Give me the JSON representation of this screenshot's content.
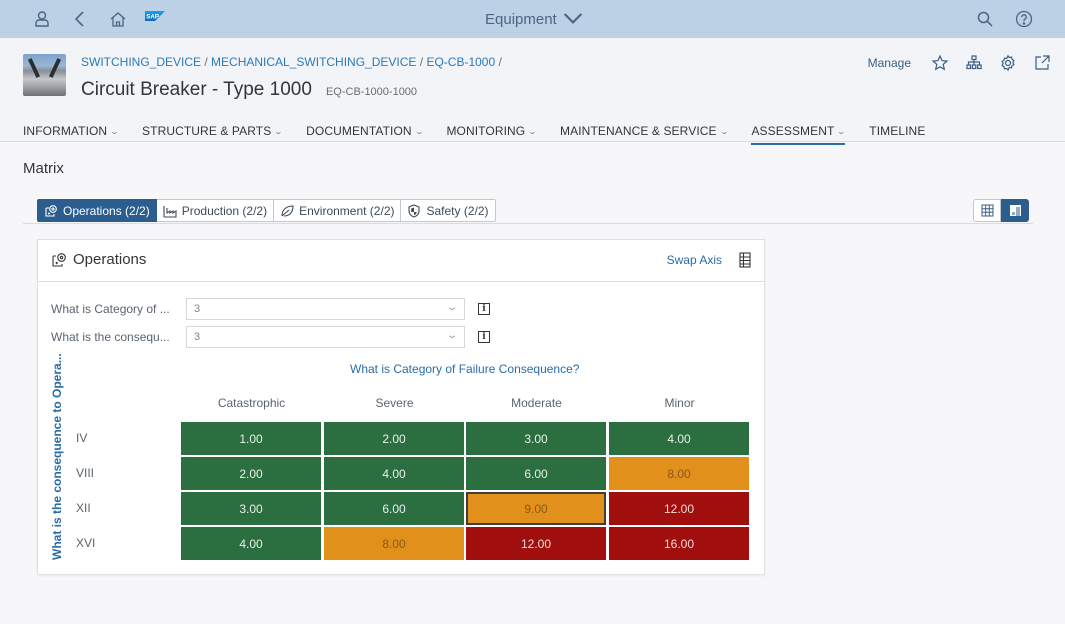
{
  "shell": {
    "title": "Equipment",
    "logo_text": "SAP",
    "icons": [
      "user-icon",
      "back-icon",
      "home-icon",
      "search-icon",
      "help-icon"
    ]
  },
  "header": {
    "breadcrumbs": [
      "SWITCHING_DEVICE",
      "MECHANICAL_SWITCHING_DEVICE",
      "EQ-CB-1000"
    ],
    "breadcrumb_separator": "/",
    "title": "Circuit Breaker - Type 1000",
    "subtitle": "EQ-CB-1000-1000",
    "manage_label": "Manage"
  },
  "nav": {
    "items": [
      {
        "label": "INFORMATION",
        "has_menu": true
      },
      {
        "label": "STRUCTURE & PARTS",
        "has_menu": true
      },
      {
        "label": "DOCUMENTATION",
        "has_menu": true
      },
      {
        "label": "MONITORING",
        "has_menu": true
      },
      {
        "label": "MAINTENANCE & SERVICE",
        "has_menu": true
      },
      {
        "label": "ASSESSMENT",
        "has_menu": true,
        "active": true
      },
      {
        "label": "TIMELINE",
        "has_menu": false
      }
    ]
  },
  "section": {
    "title": "Matrix"
  },
  "segments": [
    {
      "label": "Operations (2/2)",
      "icon": "operations-icon",
      "selected": true
    },
    {
      "label": "Production (2/2)",
      "icon": "production-icon",
      "selected": false
    },
    {
      "label": "Environment (2/2)",
      "icon": "environment-icon",
      "selected": false
    },
    {
      "label": "Safety (2/2)",
      "icon": "safety-icon",
      "selected": false
    }
  ],
  "card": {
    "title": "Operations",
    "swap_label": "Swap Axis",
    "filters": [
      {
        "label": "What is Category of ...",
        "value": "3"
      },
      {
        "label": "What is the consequ...",
        "value": "3"
      }
    ]
  },
  "matrix": {
    "x_title": "What is Category of Failure Consequence?",
    "y_title": "What is the consequence to Opera...",
    "columns": [
      "Catastrophic",
      "Severe",
      "Moderate",
      "Minor"
    ],
    "rows": [
      "IV",
      "VIII",
      "XII",
      "XVI"
    ],
    "values": [
      [
        "1.00",
        "2.00",
        "3.00",
        "4.00"
      ],
      [
        "2.00",
        "4.00",
        "6.00",
        "8.00"
      ],
      [
        "3.00",
        "6.00",
        "9.00",
        "12.00"
      ],
      [
        "4.00",
        "8.00",
        "12.00",
        "16.00"
      ]
    ],
    "levels": [
      [
        "green",
        "green",
        "green",
        "green"
      ],
      [
        "green",
        "green",
        "green",
        "orange"
      ],
      [
        "green",
        "green",
        "orange",
        "red"
      ],
      [
        "green",
        "orange",
        "red",
        "red"
      ]
    ],
    "selected_cell": {
      "row": 2,
      "col": 2
    },
    "colors": {
      "green": "#2b6e3f",
      "orange": "#e0901b",
      "red": "#a00e0e"
    }
  }
}
